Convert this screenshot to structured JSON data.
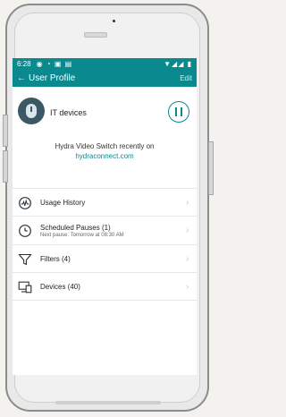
{
  "statusbar": {
    "time": "6:28",
    "left_icons": "◉ ◔ ▣ ▤",
    "right_icons": "▼◢◢ ▮"
  },
  "appbar": {
    "back_symbol": "←",
    "title": "User Profile",
    "edit": "Edit"
  },
  "profile": {
    "name": "IT devices",
    "recent_text": "Hydra Video Switch recently on",
    "recent_link": "hydraconnect.com"
  },
  "menu": {
    "items": [
      {
        "label": "Usage History",
        "sub": ""
      },
      {
        "label": "Scheduled Pauses (1)",
        "sub": "Next pause: Tomorrow at 08:30 AM"
      },
      {
        "label": "Filters (4)",
        "sub": ""
      },
      {
        "label": "Devices (40)",
        "sub": ""
      }
    ]
  },
  "colors": {
    "accent": "#0a8a8f",
    "accent_text": "#ffffff"
  },
  "icons": {
    "back": "back-arrow-icon",
    "pause": "pause-icon",
    "usage": "usage-history-icon",
    "clock": "clock-icon",
    "filter": "filter-icon",
    "devices": "devices-icon",
    "chevron": "chevron-right-icon"
  }
}
